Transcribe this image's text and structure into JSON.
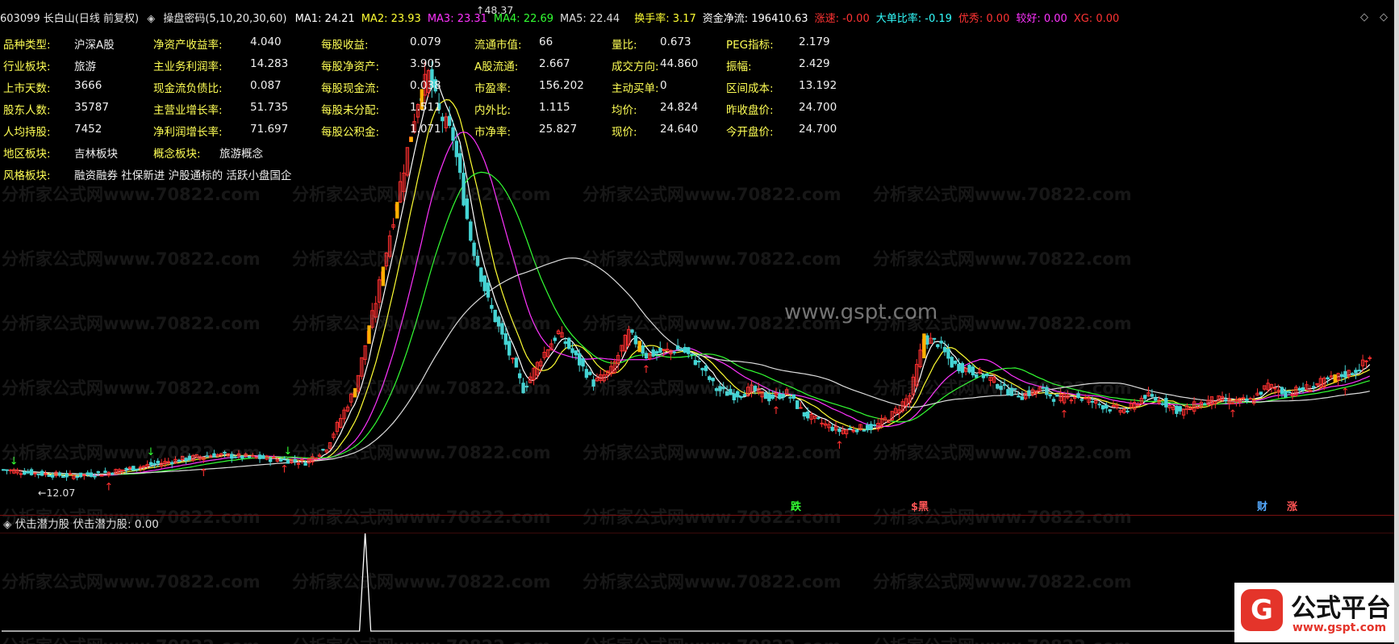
{
  "header": {
    "code_title": "603099 长白山(日线 前复权)",
    "indicator": "操盘密码(5,10,20,30,60)",
    "ma": [
      {
        "text": "MA1: 24.21",
        "color": "#ffffff"
      },
      {
        "text": "MA2: 23.93",
        "color": "#ffff33"
      },
      {
        "text": "MA3: 23.31",
        "color": "#ff33ff"
      },
      {
        "text": "MA4: 22.69",
        "color": "#33ff33"
      },
      {
        "text": "MA5: 22.44",
        "color": "#dddddd"
      }
    ],
    "extra": [
      {
        "text": "换手率: 3.17",
        "color": "#ffff33"
      },
      {
        "text": "资金净流: 196410.63",
        "color": "#ffffff"
      },
      {
        "text": "涨速: -0.00",
        "color": "#ff3333"
      },
      {
        "text": "大单比率: -0.19",
        "color": "#33ffff"
      },
      {
        "text": "优秀: 0.00",
        "color": "#ff3333"
      },
      {
        "text": "较好: 0.00",
        "color": "#ff33ff"
      },
      {
        "text": "XG: 0.00",
        "color": "#ff3333"
      }
    ],
    "icons": [
      "restore-icon",
      "diamond-icon"
    ]
  },
  "info": [
    [
      [
        "品种类型:",
        "沪深A股"
      ],
      [
        "净资产收益率:",
        "4.040"
      ],
      [
        "每股收益:",
        "0.079"
      ],
      [
        "流通市值:",
        "66"
      ],
      [
        "量比:",
        "0.673"
      ],
      [
        "PEG指标:",
        "2.179"
      ]
    ],
    [
      [
        "行业板块:",
        "旅游"
      ],
      [
        "主业务利润率:",
        "14.283"
      ],
      [
        "每股净资产:",
        "3.905"
      ],
      [
        "A股流通:",
        "2.667"
      ],
      [
        "成交方向:",
        "44.860"
      ],
      [
        "振幅:",
        "2.429"
      ]
    ],
    [
      [
        "上市天数:",
        "3666"
      ],
      [
        "现金流负债比:",
        "0.087"
      ],
      [
        "每股现金流:",
        "0.038"
      ],
      [
        "市盈率:",
        "156.202"
      ],
      [
        "主动买单:",
        "0"
      ],
      [
        "区间成本:",
        "13.192"
      ]
    ],
    [
      [
        "股东人数:",
        "35787"
      ],
      [
        "主营业增长率:",
        "51.735"
      ],
      [
        "每股未分配:",
        "1.511"
      ],
      [
        "内外比:",
        "1.115"
      ],
      [
        "均价:",
        "24.824"
      ],
      [
        "昨收盘价:",
        "24.700"
      ]
    ],
    [
      [
        "人均持股:",
        "7452"
      ],
      [
        "净利润增长率:",
        "71.697"
      ],
      [
        "每股公积金:",
        "1.071"
      ],
      [
        "市净率:",
        "25.827"
      ],
      [
        "现价:",
        "24.640"
      ],
      [
        "今开盘价:",
        "24.700"
      ]
    ],
    [
      [
        "地区板块:",
        "吉林板块"
      ],
      [
        "概念板块:",
        "旅游概念"
      ]
    ],
    [
      [
        "风格板块:",
        "融资融券 社保新进 沪股通标的 活跃小盘国企"
      ]
    ]
  ],
  "chart_data": {
    "type": "candlestick",
    "symbol": "603099 长白山",
    "period": "日线 前复权",
    "annotations": {
      "high": 48.37,
      "low": 12.07
    },
    "ma_last": {
      "MA1": 24.21,
      "MA2": 23.93,
      "MA3": 23.31,
      "MA4": 22.69,
      "MA5": 22.44
    },
    "close_path": [
      [
        0,
        13.6
      ],
      [
        10,
        13.3
      ],
      [
        20,
        13.1
      ],
      [
        30,
        13.4
      ],
      [
        40,
        13.9
      ],
      [
        50,
        14.4
      ],
      [
        60,
        14.8
      ],
      [
        70,
        14.6
      ],
      [
        80,
        14.4
      ],
      [
        86,
        14.2
      ],
      [
        92,
        15.4
      ],
      [
        100,
        20
      ],
      [
        106,
        27
      ],
      [
        112,
        35
      ],
      [
        118,
        43
      ],
      [
        121,
        45
      ],
      [
        124,
        42
      ],
      [
        128,
        40
      ],
      [
        133,
        32
      ],
      [
        138,
        27
      ],
      [
        143,
        23.5
      ],
      [
        148,
        20
      ],
      [
        153,
        22.5
      ],
      [
        158,
        24.5
      ],
      [
        163,
        22.5
      ],
      [
        168,
        20.5
      ],
      [
        173,
        21.5
      ],
      [
        178,
        24.5
      ],
      [
        183,
        22.7
      ],
      [
        188,
        23
      ],
      [
        193,
        23.2
      ],
      [
        198,
        22
      ],
      [
        203,
        20
      ],
      [
        208,
        19.5
      ],
      [
        213,
        20
      ],
      [
        218,
        19.3
      ],
      [
        223,
        19.7
      ],
      [
        228,
        18
      ],
      [
        233,
        17.3
      ],
      [
        238,
        16.7
      ],
      [
        243,
        16.9
      ],
      [
        248,
        17
      ],
      [
        253,
        18
      ],
      [
        258,
        19.5
      ],
      [
        262,
        24
      ],
      [
        266,
        23.7
      ],
      [
        270,
        22
      ],
      [
        275,
        21.5
      ],
      [
        280,
        21
      ],
      [
        285,
        20
      ],
      [
        290,
        19.5
      ],
      [
        295,
        20
      ],
      [
        300,
        19.2
      ],
      [
        305,
        19.5
      ],
      [
        310,
        19
      ],
      [
        315,
        18.5
      ],
      [
        320,
        18.3
      ],
      [
        325,
        19.5
      ],
      [
        330,
        19
      ],
      [
        335,
        18.2
      ],
      [
        340,
        18.8
      ],
      [
        345,
        19.2
      ],
      [
        350,
        19
      ],
      [
        355,
        19.1
      ],
      [
        360,
        20.3
      ],
      [
        365,
        19.7
      ],
      [
        370,
        20
      ],
      [
        375,
        20.5
      ],
      [
        380,
        21
      ],
      [
        385,
        21.5
      ],
      [
        389,
        22.5
      ]
    ],
    "volume_spike": {
      "index": 103,
      "value": 1.0
    },
    "labels": [
      "跌",
      "$黑",
      "财",
      "涨"
    ]
  },
  "lower": {
    "title": "伏击潜力股",
    "value_text": "伏击潜力股: 0.00"
  },
  "watermarks": {
    "site": "分析家公式网www.70822.com",
    "gspt": "www.gspt.com"
  },
  "logo": {
    "badge": "G",
    "title": "公式平台",
    "url": "www.gspt.com"
  },
  "colors": {
    "up": "#ff3030",
    "down": "#44d4d4",
    "ma1": "#ffffff",
    "ma2": "#ffff33",
    "ma3": "#ff33ff",
    "ma4": "#33ff33",
    "ma5": "#dddddd",
    "signal_gold": "#ffb000",
    "sep": "#7a1010"
  }
}
